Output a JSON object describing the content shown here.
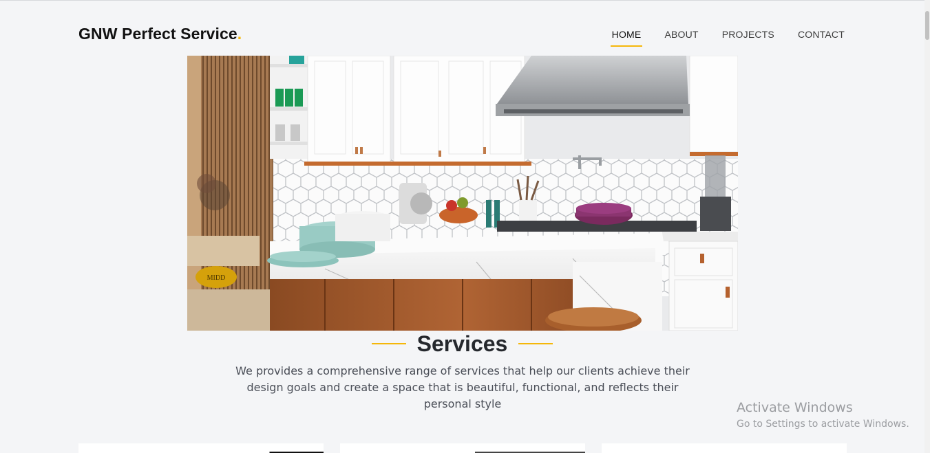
{
  "header": {
    "logo": "GNW Perfect Service",
    "logo_dot": ".",
    "nav": [
      "HOME",
      "ABOUT",
      "PROJECTS",
      "CONTACT"
    ],
    "active_nav": "HOME"
  },
  "hero": {
    "image": "kitchen-photo",
    "badge": "MIDD"
  },
  "services": {
    "title": "Services",
    "description": "We provides a comprehensive range of services that help our clients achieve their design goals and create a space that is beautiful, functional, and reflects their personal style"
  },
  "watermark": {
    "title": "Activate Windows",
    "subtitle": "Go to Settings to activate Windows."
  },
  "colors": {
    "accent": "#f5b70a",
    "page_bg": "#f4f5f7",
    "heading": "#25282d"
  }
}
